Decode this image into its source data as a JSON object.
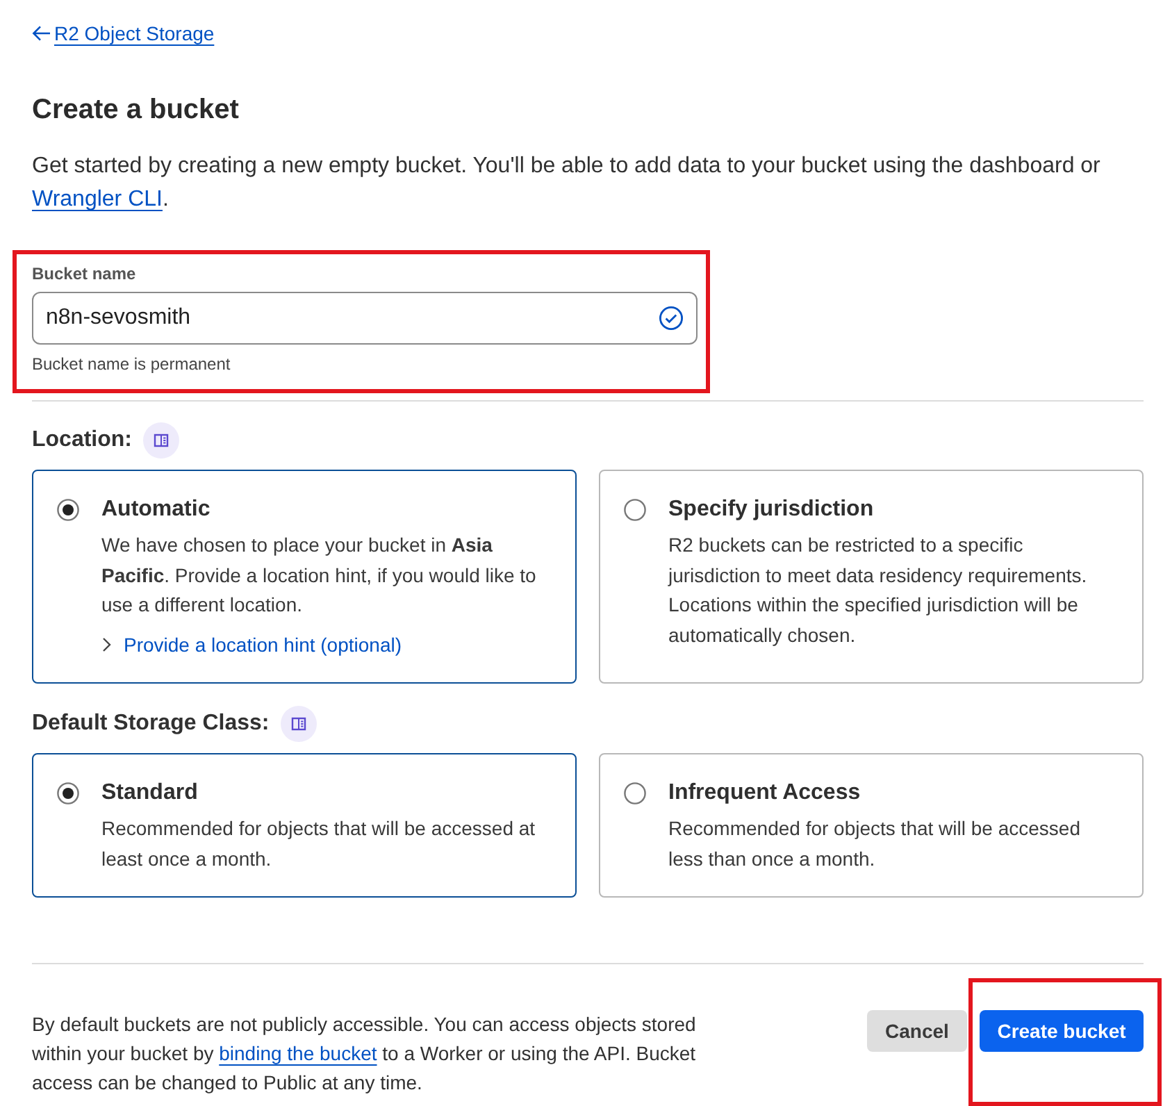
{
  "back_link": {
    "label": "R2 Object Storage"
  },
  "title": "Create a bucket",
  "intro": {
    "text": "Get started by creating a new empty bucket. You'll be able to add data to your bucket using the dashboard or",
    "link": "Wrangler CLI",
    "end": "."
  },
  "bucket_name": {
    "label": "Bucket name",
    "value": "n8n-sevosmith",
    "valid": true,
    "hint": "Bucket name is permanent",
    "highlighted": true
  },
  "location": {
    "label": "Location:",
    "options": [
      {
        "title": "Automatic",
        "description": "We have chosen to place your bucket in **Asia Pacific**. Provide a location hint, if you would like to use a different location.",
        "link": "Provide a location hint (optional)",
        "selected": true
      },
      {
        "title": "Specify jurisdiction",
        "description": "R2 buckets can be restricted to a specific jurisdiction to meet data residency requirements. Locations within the specified jurisdiction will be automatically chosen.",
        "selected": false
      }
    ]
  },
  "storage_class": {
    "label": "Default Storage Class:",
    "options": [
      {
        "title": "Standard",
        "description": "Recommended for objects that will be accessed at least once a month.",
        "selected": true
      },
      {
        "title": "Infrequent Access",
        "description": "Recommended for objects that will be accessed less than once a month.",
        "selected": false
      }
    ]
  },
  "footer": {
    "text": "By default buckets are not publicly accessible. You can access objects stored within your bucket by",
    "link": "binding the bucket",
    "end": "to a Worker or using the API. Bucket access can be changed to Public at any time."
  },
  "buttons": [
    {
      "label": "Cancel",
      "kind": "secondary",
      "highlighted": false
    },
    {
      "label": "Create bucket",
      "kind": "primary",
      "highlighted": true
    }
  ]
}
